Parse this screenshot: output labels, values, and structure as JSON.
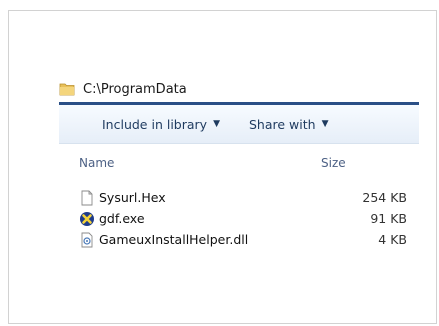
{
  "address": {
    "path": "C:\\ProgramData",
    "icon": "folder-icon"
  },
  "toolbar": {
    "include_label": "Include in library",
    "share_label": "Share with",
    "dropdown_icon": "chevron-down-icon"
  },
  "columns": {
    "name": "Name",
    "size": "Size"
  },
  "files": [
    {
      "name": "Sysurl.Hex",
      "size": "254 KB",
      "icon": "blank-file-icon"
    },
    {
      "name": "gdf.exe",
      "size": "91 KB",
      "icon": "exe-icon"
    },
    {
      "name": "GameuxInstallHelper.dll",
      "size": "4 KB",
      "icon": "dll-icon"
    }
  ],
  "colors": {
    "accent_rule": "#2a4f86",
    "toolbar_text": "#1e3a5f",
    "header_text": "#4d6185"
  }
}
